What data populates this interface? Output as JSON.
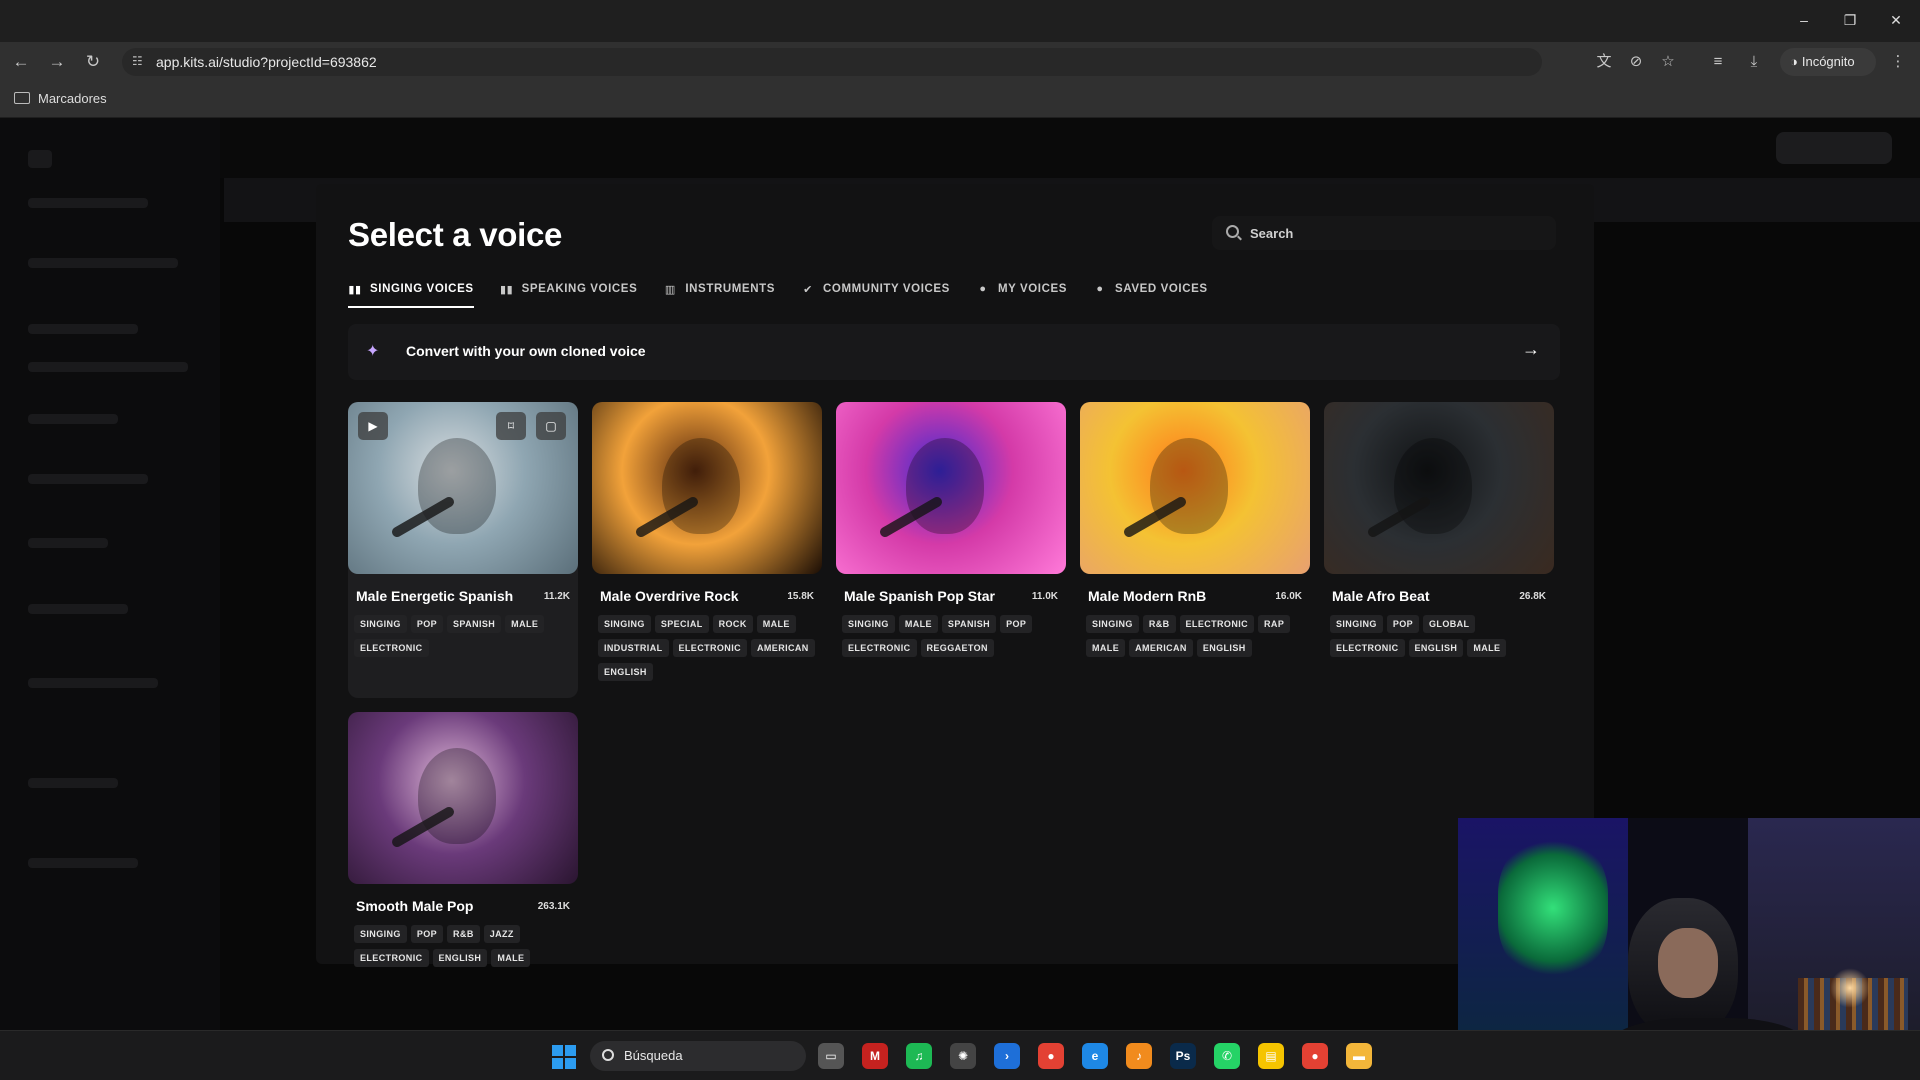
{
  "browser": {
    "window_controls": {
      "minimize": "–",
      "restore": "❐",
      "close": "✕"
    },
    "nav": {
      "back": "←",
      "forward": "→",
      "reload": "↻"
    },
    "url": "app.kits.ai/studio?projectId=693862",
    "site_info_icon": "tune-icon",
    "toolbar_icons": [
      "translate-icon",
      "eye-off-icon",
      "star-icon",
      "media-queue-icon",
      "download-icon"
    ],
    "profile_label": "Incógnito",
    "menu_icon": "⋮",
    "bookmarks_folder": "Marcadores"
  },
  "modal": {
    "title": "Select a voice",
    "search_placeholder": "Search",
    "tabs": [
      {
        "label": "SINGING VOICES",
        "icon": "waveform-icon",
        "active": true
      },
      {
        "label": "SPEAKING VOICES",
        "icon": "waveform-icon",
        "active": false
      },
      {
        "label": "INSTRUMENTS",
        "icon": "piano-icon",
        "active": false
      },
      {
        "label": "COMMUNITY VOICES",
        "icon": "check-badge-icon",
        "active": false
      },
      {
        "label": "MY VOICES",
        "icon": "user-icon",
        "active": false
      },
      {
        "label": "SAVED VOICES",
        "icon": "user-icon",
        "active": false
      }
    ],
    "banner": {
      "text": "Convert with your own cloned voice",
      "icon": "sparkle-icon",
      "arrow": "→"
    },
    "voices": [
      {
        "name": "Male Energetic Spanish",
        "count": "11.2K",
        "tags": [
          "SINGING",
          "POP",
          "SPANISH",
          "MALE",
          "ELECTRONIC"
        ],
        "palette": [
          "#8fa6b2",
          "#d8dde0",
          "#5b6f7a"
        ]
      },
      {
        "name": "Male Overdrive Rock",
        "count": "15.8K",
        "tags": [
          "SINGING",
          "SPECIAL",
          "ROCK",
          "MALE",
          "INDUSTRIAL",
          "ELECTRONIC",
          "AMERICAN",
          "ENGLISH"
        ],
        "palette": [
          "#f2a23a",
          "#5a2a0e",
          "#1a0d05"
        ]
      },
      {
        "name": "Male Spanish Pop Star",
        "count": "11.0K",
        "tags": [
          "SINGING",
          "MALE",
          "SPANISH",
          "POP",
          "ELECTRONIC",
          "REGGAETON"
        ],
        "palette": [
          "#d43aa8",
          "#3f2bd0",
          "#ff7ad9"
        ]
      },
      {
        "name": "Male Modern RnB",
        "count": "16.0K",
        "tags": [
          "SINGING",
          "R&B",
          "ELECTRONIC",
          "RAP",
          "MALE",
          "AMERICAN",
          "ENGLISH"
        ],
        "palette": [
          "#f4c233",
          "#ff7a1a",
          "#e8a070"
        ]
      },
      {
        "name": "Male Afro Beat",
        "count": "26.8K",
        "tags": [
          "SINGING",
          "POP",
          "GLOBAL",
          "ELECTRONIC",
          "ENGLISH",
          "MALE"
        ],
        "palette": [
          "#2b2f33",
          "#111315",
          "#3a2a20"
        ]
      },
      {
        "name": "Smooth Male Pop",
        "count": "263.1K",
        "tags": [
          "SINGING",
          "POP",
          "R&B",
          "JAZZ",
          "ELECTRONIC",
          "ENGLISH",
          "MALE"
        ],
        "palette": [
          "#6a3a7a",
          "#e0b8d8",
          "#2a1530"
        ]
      }
    ],
    "card_buttons": {
      "play": "▶",
      "save": "🔖",
      "select": "▢"
    }
  },
  "taskbar": {
    "search_label": "Búsqueda",
    "apps": [
      {
        "name": "task-view-icon",
        "glyph": "▭",
        "color": "#555"
      },
      {
        "name": "gmail-icon",
        "glyph": "M",
        "color": "#c5221f"
      },
      {
        "name": "spotify-icon",
        "glyph": "♫",
        "color": "#1db954"
      },
      {
        "name": "chatgpt-icon",
        "glyph": "✺",
        "color": "#444"
      },
      {
        "name": "terminal-icon",
        "glyph": "›",
        "color": "#1e6fd8"
      },
      {
        "name": "chrome-icon",
        "glyph": "●",
        "color": "#e34133"
      },
      {
        "name": "edge-icon",
        "glyph": "e",
        "color": "#1e88e5"
      },
      {
        "name": "fl-studio-icon",
        "glyph": "♪",
        "color": "#f18b1d"
      },
      {
        "name": "photoshop-icon",
        "glyph": "Ps",
        "color": "#0a2a4a"
      },
      {
        "name": "whatsapp-icon",
        "glyph": "✆",
        "color": "#25d366"
      },
      {
        "name": "sticky-notes-icon",
        "glyph": "▤",
        "color": "#f5c400"
      },
      {
        "name": "chrome-incognito-icon",
        "glyph": "●",
        "color": "#e34133"
      },
      {
        "name": "file-explorer-icon",
        "glyph": "▬",
        "color": "#f3b63a"
      }
    ]
  }
}
